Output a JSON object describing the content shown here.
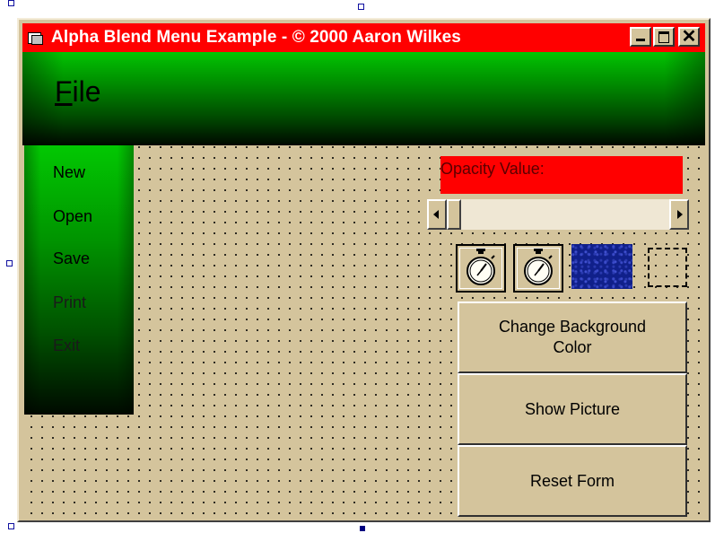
{
  "window": {
    "title": "Alpha Blend Menu Example - © 2000 Aaron Wilkes",
    "minimize_glyph": "",
    "close_glyph": "✕"
  },
  "menu": {
    "file_access_key": "F",
    "file_rest": "ile",
    "items": [
      {
        "label": "New"
      },
      {
        "label": "Open"
      },
      {
        "label": "Save"
      },
      {
        "label": "Print"
      },
      {
        "label": "Exit"
      }
    ]
  },
  "controls": {
    "opacity_label": "Opacity Value:",
    "slider_value": 0.0,
    "buttons": {
      "change_bg": "Change Background Color",
      "show_picture": "Show Picture",
      "reset_form": "Reset Form"
    },
    "icons": [
      "stopwatch-icon",
      "stopwatch-icon",
      "picture-box",
      "dashed-image-placeholder"
    ]
  },
  "colors": {
    "title_bar": "#ff0000",
    "form_background": "#d4c49c",
    "menu_gradient_top": "#02c402",
    "menu_gradient_bottom": "#000800",
    "opacity_label_bg": "#ff0000"
  }
}
